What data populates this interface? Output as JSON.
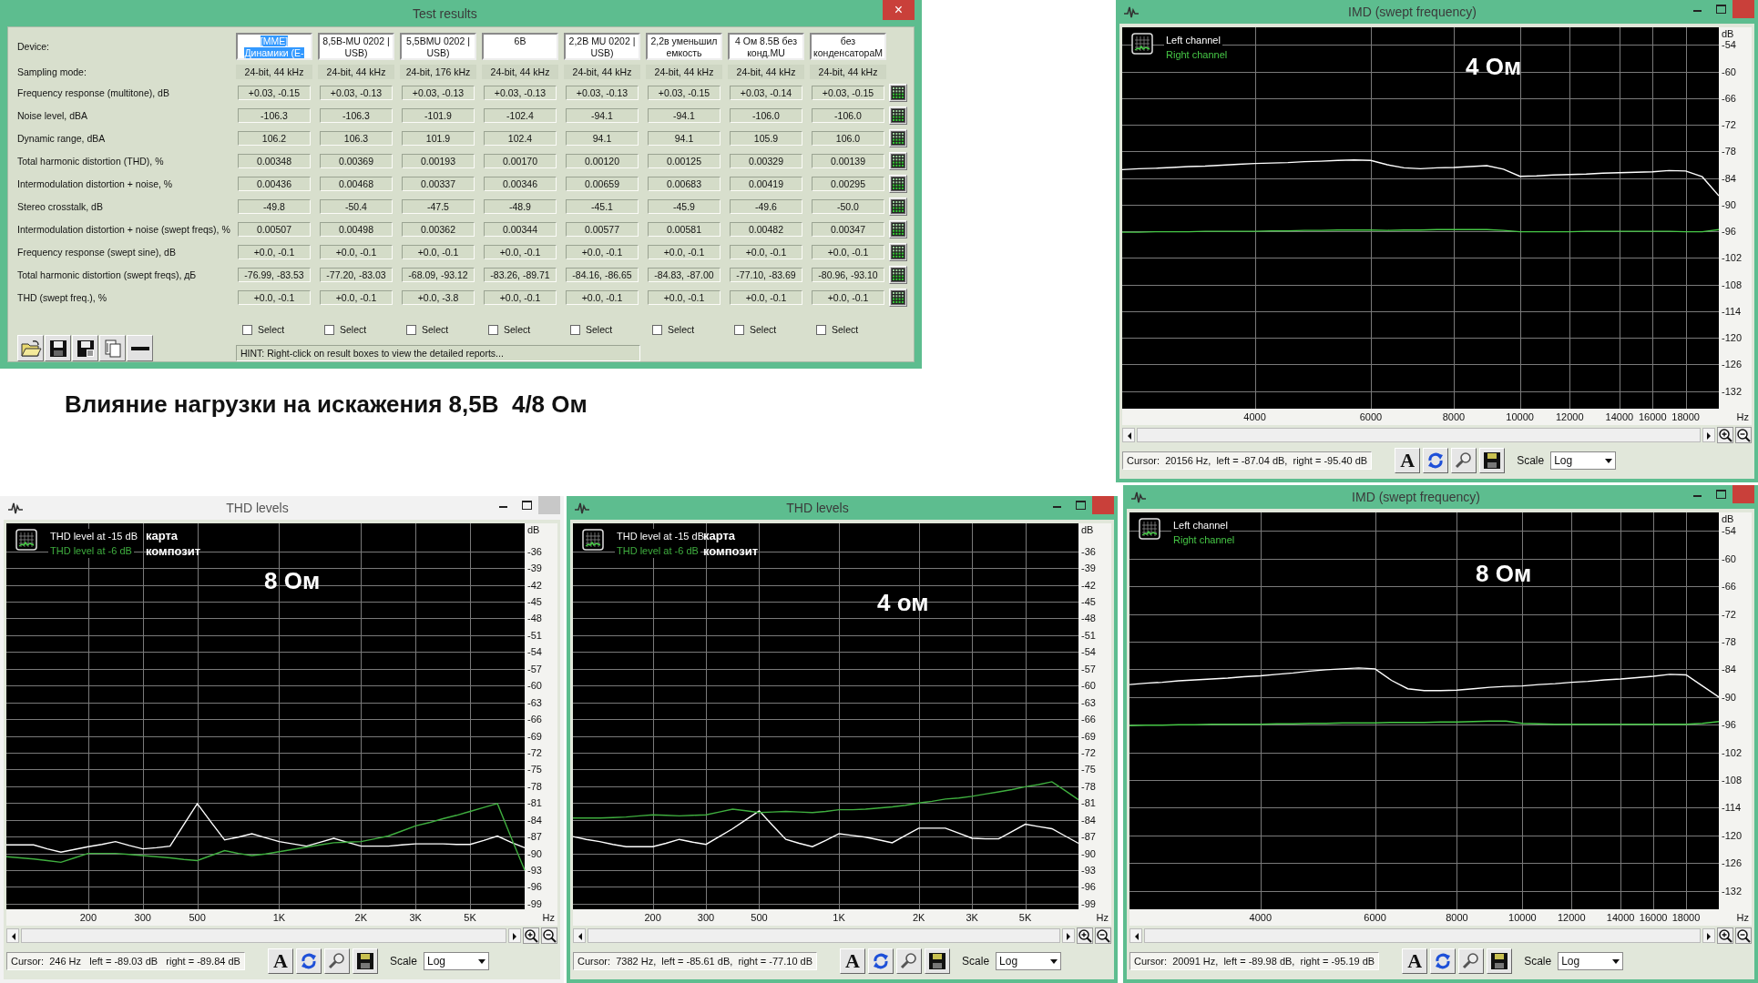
{
  "test_results": {
    "title": "Test results",
    "active": true,
    "close_glyph": "×",
    "device_label": "Device:",
    "sampling_label": "Sampling mode:",
    "devices": [
      {
        "name": "[MME] Динамики (E-",
        "selected": true,
        "sampling": "24-bit, 44 kHz",
        "select": {
          "label": "Select",
          "checked": false
        }
      },
      {
        "name": "8,5В-MU 0202 | USB)",
        "selected": false,
        "sampling": "24-bit, 44 kHz",
        "select": {
          "label": "Select",
          "checked": false
        }
      },
      {
        "name": "5,5ВMU 0202 | USB)",
        "selected": false,
        "sampling": "24-bit, 176 kHz",
        "select": {
          "label": "Select",
          "checked": false
        }
      },
      {
        "name": "6В",
        "selected": false,
        "sampling": "24-bit, 44 kHz",
        "select": {
          "label": "Select",
          "checked": false
        }
      },
      {
        "name": "2,2В MU 0202 | USB)",
        "selected": false,
        "sampling": "24-bit, 44 kHz",
        "select": {
          "label": "Select",
          "checked": false
        }
      },
      {
        "name": "2,2в уменьшил емкость",
        "selected": false,
        "sampling": "24-bit, 44 kHz",
        "select": {
          "label": "Select",
          "checked": false
        }
      },
      {
        "name": "4 Ом 8.5В без конд.MU",
        "selected": false,
        "sampling": "24-bit, 44 kHz",
        "select": {
          "label": "Select",
          "checked": false
        }
      },
      {
        "name": "без конденсатораМ",
        "selected": false,
        "sampling": "24-bit, 44 kHz",
        "select": {
          "label": "Select",
          "checked": false
        }
      }
    ],
    "rows": [
      {
        "label": "Frequency response (multitone), dB",
        "values": [
          "+0.03, -0.15",
          "+0.03, -0.13",
          "+0.03, -0.13",
          "+0.03, -0.13",
          "+0.03, -0.13",
          "+0.03, -0.15",
          "+0.03, -0.14",
          "+0.03, -0.15"
        ]
      },
      {
        "label": "Noise level, dBA",
        "values": [
          "-106.3",
          "-106.3",
          "-101.9",
          "-102.4",
          "-94.1",
          "-94.1",
          "-106.0",
          "-106.0"
        ]
      },
      {
        "label": "Dynamic range, dBA",
        "values": [
          "106.2",
          "106.3",
          "101.9",
          "102.4",
          "94.1",
          "94.1",
          "105.9",
          "106.0"
        ]
      },
      {
        "label": "Total harmonic distortion (THD), %",
        "values": [
          "0.00348",
          "0.00369",
          "0.00193",
          "0.00170",
          "0.00120",
          "0.00125",
          "0.00329",
          "0.00139"
        ]
      },
      {
        "label": "Intermodulation distortion + noise, %",
        "values": [
          "0.00436",
          "0.00468",
          "0.00337",
          "0.00346",
          "0.00659",
          "0.00683",
          "0.00419",
          "0.00295"
        ]
      },
      {
        "label": "Stereo crosstalk, dB",
        "values": [
          "-49.8",
          "-50.4",
          "-47.5",
          "-48.9",
          "-45.1",
          "-45.9",
          "-49.6",
          "-50.0"
        ]
      },
      {
        "label": "Intermodulation distortion + noise (swept freqs), %",
        "values": [
          "0.00507",
          "0.00498",
          "0.00362",
          "0.00344",
          "0.00577",
          "0.00581",
          "0.00482",
          "0.00347"
        ]
      },
      {
        "label": "Frequency response (swept sine), dB",
        "values": [
          "+0.0, -0.1",
          "+0.0, -0.1",
          "+0.0, -0.1",
          "+0.0, -0.1",
          "+0.0, -0.1",
          "+0.0, -0.1",
          "+0.0, -0.1",
          "+0.0, -0.1"
        ]
      },
      {
        "label": "Total harmonic distortion (swept freqs), дБ",
        "values": [
          "-76.99, -83.53",
          "-77.20, -83.03",
          "-68.09, -93.12",
          "-83.26, -89.71",
          "-84.16, -86.65",
          "-84.83, -87.00",
          "-77.10, -83.69",
          "-80.96, -93.10"
        ]
      },
      {
        "label": "THD (swept freq.), %",
        "values": [
          "+0.0, -0.1",
          "+0.0, -0.1",
          "+0.0, -3.8",
          "+0.0, -0.1",
          "+0.0, -0.1",
          "+0.0, -0.1",
          "+0.0, -0.1",
          "+0.0, -0.1"
        ]
      }
    ],
    "toolbar": [
      {
        "kind": "open"
      },
      {
        "kind": "save"
      },
      {
        "kind": "save-report"
      },
      {
        "kind": "copy"
      },
      {
        "kind": "minus"
      }
    ],
    "hint": "HINT: Right-click on result boxes to view the detailed reports..."
  },
  "caption": "Влияние нагрузки на искажения 8,5В  4/8 Ом",
  "chart_windows": [
    {
      "title": "IMD (swept frequency)",
      "active": true,
      "impedance_label": "4 Ом",
      "cursor": "Cursor:  20156 Hz,  left = -87.04 dB,  right = -95.40 dB",
      "scale_label": "Scale",
      "scale": "Log",
      "tools": [
        {
          "kind": "font",
          "glyph": "A"
        },
        {
          "kind": "refresh"
        },
        {
          "kind": "magnifier"
        },
        {
          "kind": "save"
        }
      ],
      "chart_data": {
        "type": "line",
        "grid": true,
        "xlabel": "Hz",
        "ylabel": "dB",
        "categories": [
          null,
          null,
          null,
          null,
          null,
          null,
          null,
          null,
          "4000",
          null,
          null,
          null,
          null,
          null,
          null,
          "6000",
          null,
          null,
          null,
          null,
          "8000",
          null,
          null,
          null,
          "10000",
          null,
          null,
          "12000",
          null,
          null,
          "14000",
          null,
          "16000",
          null,
          "18000",
          null,
          null
        ],
        "series": [
          {
            "name": "Left channel",
            "color": "#ffffff",
            "values": [
              -82.1,
              -81.9,
              -81.8,
              -81.6,
              -81.4,
              -81.3,
              -81.1,
              -80.9,
              -80.7,
              -80.6,
              -80.5,
              -80.3,
              -80.2,
              -80.0,
              -79.9,
              -80.0,
              -81.0,
              -81.7,
              -81.9,
              -81.7,
              -81.6,
              -81.4,
              -81.2,
              -82.0,
              -83.6,
              -83.5,
              -83.3,
              -83.2,
              -83.1,
              -82.9,
              -82.8,
              -82.7,
              -82.6,
              -82.3,
              -82.4,
              -83.7,
              -88.0
            ]
          },
          {
            "name": "Right channel",
            "color": "#46c846",
            "values": [
              -96.2,
              -96.2,
              -96.1,
              -96.1,
              -96.1,
              -96.0,
              -96.0,
              -96.0,
              -96.0,
              -95.9,
              -95.9,
              -95.8,
              -95.8,
              -95.7,
              -95.7,
              -95.7,
              -95.8,
              -95.7,
              -95.7,
              -95.6,
              -95.6,
              -95.6,
              -95.6,
              -95.8,
              -96.1,
              -96.1,
              -96.1,
              -96.1,
              -96.0,
              -96.0,
              -96.0,
              -96.0,
              -96.0,
              -96.0,
              -96.1,
              -96.1,
              -95.6
            ]
          }
        ],
        "ylim": [
          -136,
          -50
        ],
        "yticks": [
          -54,
          -60,
          -66,
          -72,
          -78,
          -84,
          -90,
          -96,
          -102,
          -108,
          -114,
          -120,
          -126,
          -132
        ]
      }
    },
    {
      "title": "THD levels",
      "active": false,
      "notes": [
        "карта",
        "композит"
      ],
      "impedance_label": "8 Ом",
      "cursor": "Cursor:  246 Hz   left = -89.03 dB   right = -89.84 dB",
      "scale_label": "Scale",
      "scale": "Log",
      "tools": [
        {
          "kind": "font",
          "glyph": "A"
        },
        {
          "kind": "refresh"
        },
        {
          "kind": "magnifier"
        },
        {
          "kind": "save"
        }
      ],
      "chart_data": {
        "type": "line",
        "grid": true,
        "xlabel": "Hz",
        "ylabel": "dB",
        "categories": [
          null,
          null,
          null,
          null,
          null,
          null,
          "200",
          null,
          null,
          null,
          "300",
          null,
          null,
          null,
          "500",
          null,
          null,
          null,
          null,
          null,
          "1K",
          null,
          null,
          null,
          null,
          null,
          "2K",
          null,
          null,
          null,
          "3K",
          null,
          null,
          null,
          "5K",
          null,
          null,
          null,
          null
        ],
        "series": [
          {
            "name": "THD level at -15 dB",
            "color": "#ffffff",
            "values": [
              -88.5,
              -88.5,
              -88.5,
              -89.2,
              -89.8,
              -89.3,
              -88.8,
              -88.4,
              -87.9,
              -88.6,
              -89.2,
              -89.0,
              -88.7,
              -84.9,
              -81.1,
              -84.4,
              -87.6,
              -87.1,
              -86.5,
              -87.2,
              -87.9,
              -88.3,
              -88.7,
              -88.0,
              -87.3,
              -88.0,
              -88.7,
              -88.7,
              -88.7,
              -88.5,
              -88.3,
              -88.3,
              -88.3,
              -88.4,
              -88.4,
              -87.7,
              -86.9,
              -88.0,
              -89.0
            ]
          },
          {
            "name": "THD level at -6 dB",
            "color": "#3fae3f",
            "values": [
              -90.6,
              -90.8,
              -91.0,
              -91.3,
              -91.6,
              -90.8,
              -90.0,
              -90.0,
              -90.0,
              -90.2,
              -90.4,
              -90.6,
              -90.8,
              -91.1,
              -91.3,
              -90.4,
              -89.5,
              -90.0,
              -90.4,
              -90.1,
              -89.7,
              -89.3,
              -88.9,
              -88.5,
              -88.1,
              -88.0,
              -87.9,
              -87.4,
              -86.9,
              -86.0,
              -85.1,
              -84.5,
              -83.8,
              -83.2,
              -82.5,
              -81.8,
              -81.1,
              -87.1,
              -93.0
            ]
          }
        ],
        "ylim": [
          -100,
          -31
        ],
        "yticks": [
          -36,
          -39,
          -42,
          -45,
          -48,
          -51,
          -54,
          -57,
          -60,
          -63,
          -66,
          -69,
          -72,
          -75,
          -78,
          -81,
          -84,
          -87,
          -90,
          -93,
          -96,
          -99
        ]
      }
    },
    {
      "title": "THD levels",
      "active": true,
      "notes": [
        "карта",
        "композит"
      ],
      "impedance_label": "4 ом",
      "cursor": "Cursor:  7382 Hz,  left = -85.61 dB,  right = -77.10 dB",
      "scale_label": "Scale",
      "scale": "Log",
      "tools": [
        {
          "kind": "font",
          "glyph": "A"
        },
        {
          "kind": "refresh"
        },
        {
          "kind": "magnifier"
        },
        {
          "kind": "save"
        }
      ],
      "chart_data": {
        "type": "line",
        "grid": true,
        "xlabel": "Hz",
        "ylabel": "dB",
        "categories": [
          null,
          null,
          null,
          null,
          null,
          null,
          "200",
          null,
          null,
          null,
          "300",
          null,
          null,
          null,
          "500",
          null,
          null,
          null,
          null,
          null,
          "1K",
          null,
          null,
          null,
          null,
          null,
          "2K",
          null,
          null,
          null,
          "3K",
          null,
          null,
          null,
          "5K",
          null,
          null,
          null,
          null
        ],
        "series": [
          {
            "name": "THD level at -15 dB",
            "color": "#ffffff",
            "values": [
              -87.0,
              -87.5,
              -87.9,
              -88.4,
              -88.8,
              -88.8,
              -88.8,
              -88.2,
              -87.5,
              -88.0,
              -88.4,
              -87.0,
              -85.6,
              -84.0,
              -82.4,
              -85.0,
              -87.5,
              -88.2,
              -88.8,
              -87.7,
              -86.5,
              -86.8,
              -87.1,
              -87.6,
              -88.1,
              -86.8,
              -85.5,
              -85.5,
              -85.5,
              -86.4,
              -87.3,
              -87.4,
              -87.4,
              -86.1,
              -84.8,
              -85.2,
              -85.6,
              -86.9,
              -88.2
            ]
          },
          {
            "name": "THD level at -6 dB",
            "color": "#3fae3f",
            "values": [
              -83.7,
              -83.7,
              -83.7,
              -83.6,
              -83.5,
              -83.3,
              -83.1,
              -83.2,
              -83.3,
              -83.2,
              -83.1,
              -82.6,
              -82.1,
              -82.4,
              -82.7,
              -82.6,
              -82.5,
              -82.6,
              -82.7,
              -82.5,
              -82.2,
              -82.2,
              -82.1,
              -81.9,
              -81.7,
              -81.4,
              -81.0,
              -80.7,
              -80.3,
              -80.1,
              -79.8,
              -79.4,
              -79.0,
              -78.6,
              -78.1,
              -77.7,
              -77.2,
              -78.8,
              -80.4
            ]
          }
        ],
        "ylim": [
          -100,
          -31
        ],
        "yticks": [
          -36,
          -39,
          -42,
          -45,
          -48,
          -51,
          -54,
          -57,
          -60,
          -63,
          -66,
          -69,
          -72,
          -75,
          -78,
          -81,
          -84,
          -87,
          -90,
          -93,
          -96,
          -99
        ]
      }
    },
    {
      "title": "IMD (swept frequency)",
      "active": true,
      "impedance_label": "8 Ом",
      "cursor": "Cursor:  20091 Hz,  left = -89.98 dB,  right = -95.19 dB",
      "scale_label": "Scale",
      "scale": "Log",
      "tools": [
        {
          "kind": "font",
          "glyph": "A"
        },
        {
          "kind": "refresh"
        },
        {
          "kind": "magnifier"
        },
        {
          "kind": "save"
        }
      ],
      "chart_data": {
        "type": "line",
        "grid": true,
        "xlabel": "Hz",
        "ylabel": "dB",
        "categories": [
          null,
          null,
          null,
          null,
          null,
          null,
          null,
          null,
          "4000",
          null,
          null,
          null,
          null,
          null,
          null,
          "6000",
          null,
          null,
          null,
          null,
          "8000",
          null,
          null,
          null,
          "10000",
          null,
          null,
          "12000",
          null,
          null,
          "14000",
          null,
          "16000",
          null,
          "18000",
          null,
          null
        ],
        "series": [
          {
            "name": "Left channel",
            "color": "#ffffff",
            "values": [
              -87.3,
              -87.0,
              -86.8,
              -86.5,
              -86.3,
              -86.1,
              -85.9,
              -85.6,
              -85.4,
              -85.1,
              -84.8,
              -84.4,
              -84.1,
              -83.9,
              -83.7,
              -83.9,
              -86.4,
              -88.2,
              -88.6,
              -88.6,
              -88.5,
              -88.2,
              -87.9,
              -87.7,
              -87.6,
              -87.3,
              -87.1,
              -86.8,
              -86.6,
              -86.3,
              -86.1,
              -85.8,
              -85.5,
              -85.1,
              -85.2,
              -87.6,
              -90.0
            ]
          },
          {
            "name": "Right channel",
            "color": "#46c846",
            "values": [
              -96.2,
              -96.1,
              -96.1,
              -96.0,
              -96.0,
              -95.9,
              -95.9,
              -95.9,
              -95.9,
              -95.8,
              -95.8,
              -95.7,
              -95.7,
              -95.6,
              -95.6,
              -95.6,
              -95.5,
              -95.5,
              -95.5,
              -95.4,
              -95.4,
              -95.3,
              -95.2,
              -95.2,
              -95.7,
              -95.8,
              -95.9,
              -95.9,
              -95.9,
              -95.9,
              -95.9,
              -95.9,
              -95.9,
              -95.9,
              -95.9,
              -95.7,
              -95.3
            ]
          }
        ],
        "ylim": [
          -136,
          -50
        ],
        "yticks": [
          -54,
          -60,
          -66,
          -72,
          -78,
          -84,
          -90,
          -96,
          -102,
          -108,
          -114,
          -120,
          -126,
          -132
        ]
      }
    }
  ]
}
